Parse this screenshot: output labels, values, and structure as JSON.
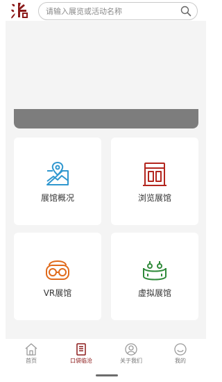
{
  "search": {
    "placeholder": "请输入展览或活动名称",
    "value": ""
  },
  "colors": {
    "brand": "#8b1a1a",
    "map_icon": "#2f97cf",
    "browse_icon": "#b3261e",
    "vr_icon": "#e06a1b",
    "virtual_icon": "#2f8a3a",
    "banner_bar": "#7d7d7d"
  },
  "cards": [
    {
      "label": "展馆概况",
      "icon": "map-icon"
    },
    {
      "label": "浏览展馆",
      "icon": "building-icon"
    },
    {
      "label": "VR展馆",
      "icon": "vr-headset-icon"
    },
    {
      "label": "虚拟展馆",
      "icon": "virtual-hall-icon"
    }
  ],
  "tabbar": {
    "items": [
      {
        "label": "首页",
        "icon": "home-icon",
        "active": false
      },
      {
        "label": "口袋临沧",
        "icon": "book-icon",
        "active": true
      },
      {
        "label": "关于我们",
        "icon": "about-icon",
        "active": false
      },
      {
        "label": "我的",
        "icon": "profile-icon",
        "active": false
      }
    ]
  }
}
